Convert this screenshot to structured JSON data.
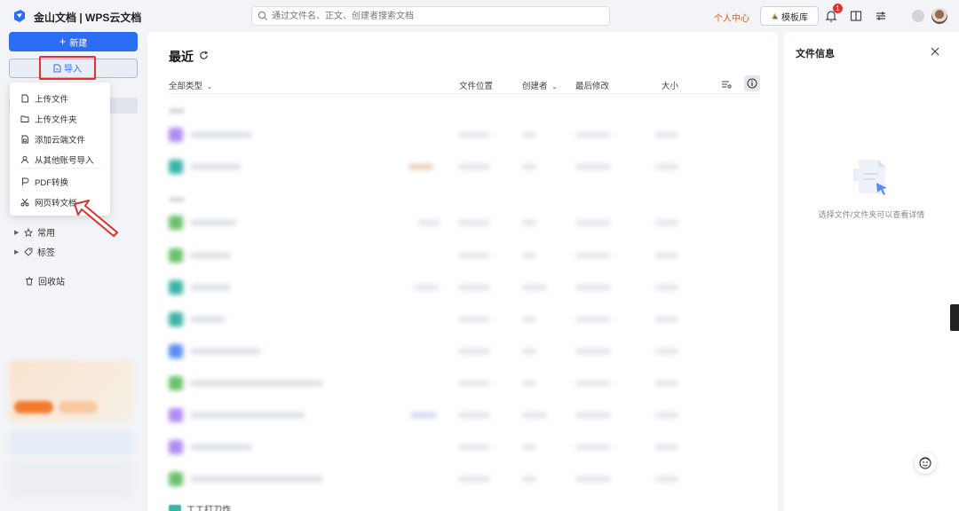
{
  "app": {
    "title": "金山文档 | WPS云文档"
  },
  "search": {
    "placeholder": "通过文件名、正文、创建者搜索文档"
  },
  "header": {
    "user_center": "个人中心",
    "template_label": "模板库",
    "notification_count": "1",
    "accent_color": "#2b6ef5",
    "alert_color": "#e8590c"
  },
  "sidebar": {
    "new_label": "新建",
    "import_label": "导入",
    "tree": [
      {
        "label": "常用",
        "icon": "pin-icon"
      },
      {
        "label": "标签",
        "icon": "tag-icon"
      }
    ],
    "trash_label": "回收站"
  },
  "import_menu": {
    "items": [
      {
        "label": "上传文件",
        "icon": "file-icon"
      },
      {
        "label": "上传文件夹",
        "icon": "folder-icon"
      },
      {
        "label": "添加云端文件",
        "icon": "cloud-file-icon"
      },
      {
        "label": "从其他账号导入",
        "icon": "user-icon"
      },
      {
        "label": "PDF转换",
        "icon": "pdf-icon"
      },
      {
        "label": "网页转文档",
        "icon": "scissors-icon"
      }
    ]
  },
  "main": {
    "title": "最近",
    "filter_label": "全部类型",
    "columns": {
      "location": "文件位置",
      "creator": "创建者",
      "modified": "最后修改",
      "size": "大小"
    },
    "last_row_name": "工工打刀炸"
  },
  "info_panel": {
    "title": "文件信息",
    "empty_text": "选择文件/文件夹可以查看详情"
  }
}
